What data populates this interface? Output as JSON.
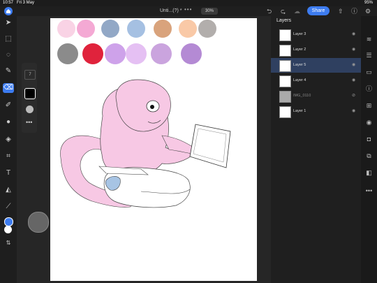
{
  "status": {
    "time": "10:57",
    "date": "Fri 3 May",
    "battery": "95%"
  },
  "document": {
    "title": "Unti...(?) *",
    "zoom": "30%",
    "menu_dots": "•••"
  },
  "toolbar": {
    "share_label": "Share",
    "undo_icon": "undo-icon",
    "redo_icon": "redo-icon",
    "cloud_icon": "cloud-icon"
  },
  "brush_panel": {
    "size": "7",
    "more": "•••"
  },
  "palette": {
    "row1": [
      "#f9d3e5",
      "#f4a9d4",
      "#92a8c6",
      "#a5c0e2",
      "#d9a37c",
      "#f9c9a7",
      "#b2aeac"
    ],
    "row2": [
      "#8b8b8b",
      "#e0233c",
      "#cea2ea",
      "#e5c0f3",
      "#caa4de",
      "#b48ad4"
    ]
  },
  "layers": {
    "title": "Layers",
    "items": [
      {
        "name": "Layer 3",
        "selected": false,
        "dim": false
      },
      {
        "name": "Layer 2",
        "selected": false,
        "dim": false
      },
      {
        "name": "Layer 5",
        "selected": true,
        "dim": false
      },
      {
        "name": "Layer 4",
        "selected": false,
        "dim": false
      },
      {
        "name": "IMG_0110",
        "selected": false,
        "dim": true
      },
      {
        "name": "Layer 1",
        "selected": false,
        "dim": false
      }
    ]
  },
  "colors": {
    "accent": "#3d7cf0",
    "primary": "#3d7cf0",
    "secondary": "#ffffff"
  }
}
